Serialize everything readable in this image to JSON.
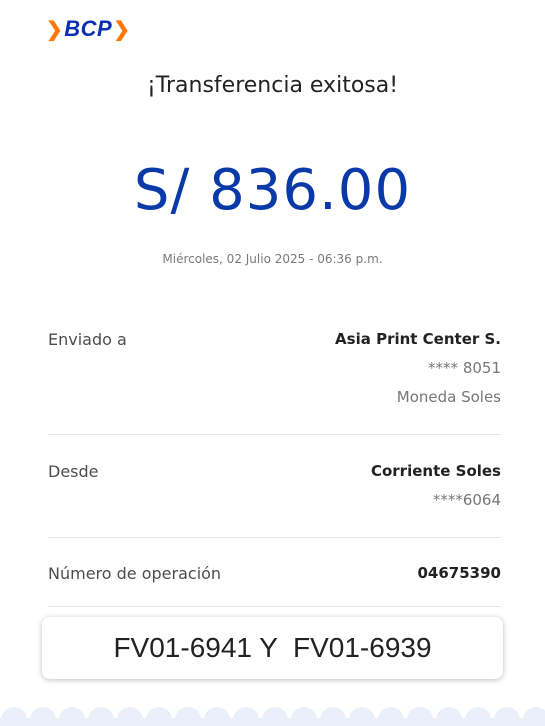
{
  "logo": {
    "icon": "bcp-chevron-logo",
    "text": "BCP",
    "brand_blue": "#0a2fb0",
    "brand_orange": "#ff7800"
  },
  "header": {
    "title": "¡Transferencia exitosa!"
  },
  "transfer": {
    "amount": "S/ 836.00",
    "datetime": "Miércoles, 02 Julio 2025 - 06:36 p.m.",
    "amount_color": "#0a3aa8"
  },
  "details": {
    "sent_to": {
      "label": "Enviado a",
      "name": "Asia Print Center S.",
      "account": "**** 8051",
      "currency": "Moneda Soles"
    },
    "from": {
      "label": "Desde",
      "account_type": "Corriente Soles",
      "account": "****6064"
    },
    "operation": {
      "label": "Número de operación",
      "number": "04675390"
    }
  },
  "reference_note": {
    "text": "FV01-6941 Y  FV01-6939"
  },
  "footer": {
    "scallop_color": "#eaf0f9"
  }
}
